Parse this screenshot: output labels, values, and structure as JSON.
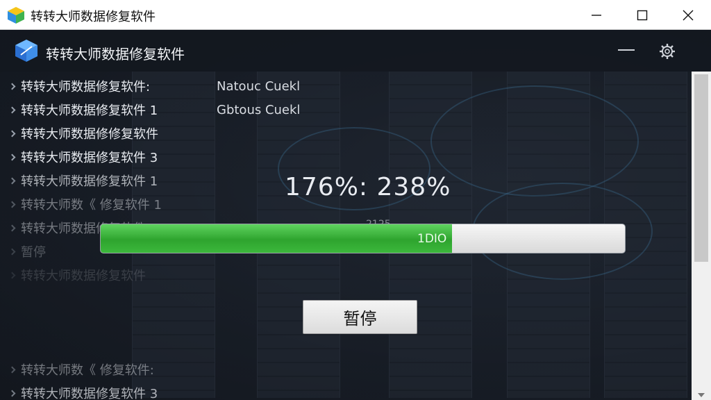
{
  "window": {
    "title": "转转大师数据修复软件"
  },
  "header": {
    "title": "转转大师数据修复软件"
  },
  "list": {
    "items": [
      {
        "label": "转转大师数据修复软件:",
        "value": "Natouc Cuekl"
      },
      {
        "label": "转转大师数据修复软件 1",
        "value": "Gbtous Cuekl"
      },
      {
        "label": "转转大师数据修修复软件",
        "value": ""
      },
      {
        "label": "转转大师数据修复软件 3",
        "value": ""
      },
      {
        "label": "转转大师数据修复软件 1",
        "value": ""
      },
      {
        "label": "转转大师数《 修复软件 1",
        "value": ""
      },
      {
        "label": "转转大师数据修复软件",
        "value": ""
      },
      {
        "label": "暂停",
        "value": ""
      },
      {
        "label": "转转大师数据修复软件",
        "value": ""
      },
      {
        "label": "转转大师数《 修复软件:",
        "value": ""
      },
      {
        "label": "转转大师数据修复软件 3",
        "value": ""
      }
    ]
  },
  "progress": {
    "percent_text": "176%: 238%",
    "sub_text": "2125",
    "bar_label": "1DIO",
    "fill_fraction": 0.67
  },
  "pause_button": {
    "label": "暂停"
  },
  "colors": {
    "progress_green": "#3cb83c",
    "background": "#1a1f27"
  },
  "icons": [
    "app-cube-icon",
    "minimize-icon",
    "maximize-icon",
    "close-icon",
    "gear-icon",
    "chevron-right-icon"
  ]
}
